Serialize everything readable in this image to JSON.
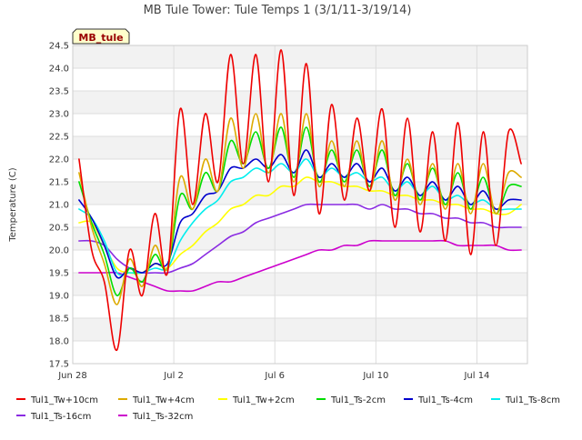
{
  "chart_data": {
    "type": "line",
    "title": "MB Tule Tower: Tule Temps 1 (3/1/11-3/19/14)",
    "xlabel": "",
    "ylabel": "Temperature (C)",
    "badge": "MB_tule",
    "xlim": [
      "2012-06-28",
      "2012-07-16"
    ],
    "ylim": [
      17.5,
      24.5
    ],
    "xticks": [
      {
        "date": "2012-06-28",
        "label": "Jun 28"
      },
      {
        "date": "2012-07-02",
        "label": "Jul 2"
      },
      {
        "date": "2012-07-06",
        "label": "Jul 6"
      },
      {
        "date": "2012-07-10",
        "label": "Jul 10"
      },
      {
        "date": "2012-07-14",
        "label": "Jul 14"
      }
    ],
    "yticks": [
      17.5,
      18.0,
      18.5,
      19.0,
      19.5,
      20.0,
      20.5,
      21.0,
      21.5,
      22.0,
      22.5,
      23.0,
      23.5,
      24.0,
      24.5
    ],
    "grid": true,
    "legend_position": "bottom",
    "series": [
      {
        "name": "Tul1_Tw+10cm",
        "color": "#ee0000",
        "x": [
          "2012-06-28T06:00",
          "2012-06-28T18:00",
          "2012-06-29T06:00",
          "2012-06-29T18:00",
          "2012-06-30T06:00",
          "2012-06-30T18:00",
          "2012-07-01T06:00",
          "2012-07-01T18:00",
          "2012-07-02T06:00",
          "2012-07-02T18:00",
          "2012-07-03T06:00",
          "2012-07-03T18:00",
          "2012-07-04T06:00",
          "2012-07-04T18:00",
          "2012-07-05T06:00",
          "2012-07-05T18:00",
          "2012-07-06T06:00",
          "2012-07-06T18:00",
          "2012-07-07T06:00",
          "2012-07-07T18:00",
          "2012-07-08T06:00",
          "2012-07-08T18:00",
          "2012-07-09T06:00",
          "2012-07-09T18:00",
          "2012-07-10T06:00",
          "2012-07-10T18:00",
          "2012-07-11T06:00",
          "2012-07-11T18:00",
          "2012-07-12T06:00",
          "2012-07-12T18:00",
          "2012-07-13T06:00",
          "2012-07-13T18:00",
          "2012-07-14T06:00",
          "2012-07-14T18:00",
          "2012-07-15T06:00",
          "2012-07-15T18:00"
        ],
        "y": [
          22.0,
          20.0,
          19.3,
          17.8,
          20.0,
          19.0,
          20.8,
          19.5,
          23.1,
          21.0,
          23.0,
          21.5,
          24.3,
          21.9,
          24.3,
          21.5,
          24.4,
          21.2,
          24.1,
          20.8,
          23.2,
          21.1,
          22.9,
          21.3,
          23.1,
          20.5,
          22.9,
          20.4,
          22.6,
          20.2,
          22.8,
          19.9,
          22.6,
          20.1,
          22.6,
          21.9
        ]
      },
      {
        "name": "Tul1_Tw+4cm",
        "color": "#ddaa00",
        "x": [
          "2012-06-28T06:00",
          "2012-06-28T18:00",
          "2012-06-29T06:00",
          "2012-06-29T18:00",
          "2012-06-30T06:00",
          "2012-06-30T18:00",
          "2012-07-01T06:00",
          "2012-07-01T18:00",
          "2012-07-02T06:00",
          "2012-07-02T18:00",
          "2012-07-03T06:00",
          "2012-07-03T18:00",
          "2012-07-04T06:00",
          "2012-07-04T18:00",
          "2012-07-05T06:00",
          "2012-07-05T18:00",
          "2012-07-06T06:00",
          "2012-07-06T18:00",
          "2012-07-07T06:00",
          "2012-07-07T18:00",
          "2012-07-08T06:00",
          "2012-07-08T18:00",
          "2012-07-09T06:00",
          "2012-07-09T18:00",
          "2012-07-10T06:00",
          "2012-07-10T18:00",
          "2012-07-11T06:00",
          "2012-07-11T18:00",
          "2012-07-12T06:00",
          "2012-07-12T18:00",
          "2012-07-13T06:00",
          "2012-07-13T18:00",
          "2012-07-14T06:00",
          "2012-07-14T18:00",
          "2012-07-15T06:00",
          "2012-07-15T18:00"
        ],
        "y": [
          21.7,
          20.5,
          19.7,
          18.8,
          19.8,
          19.2,
          20.1,
          19.6,
          21.6,
          20.9,
          22.0,
          21.3,
          22.9,
          21.8,
          23.0,
          21.7,
          23.0,
          21.5,
          23.0,
          21.4,
          22.4,
          21.4,
          22.4,
          21.3,
          22.4,
          21.1,
          22.0,
          21.0,
          21.9,
          20.9,
          21.9,
          20.8,
          21.9,
          20.8,
          21.7,
          21.6
        ]
      },
      {
        "name": "Tul1_Tw+2cm",
        "color": "#ffff00",
        "x": [
          "2012-06-28T06:00",
          "2012-06-28T18:00",
          "2012-06-29T06:00",
          "2012-06-29T18:00",
          "2012-06-30T06:00",
          "2012-06-30T18:00",
          "2012-07-01T06:00",
          "2012-07-01T18:00",
          "2012-07-02T06:00",
          "2012-07-02T18:00",
          "2012-07-03T06:00",
          "2012-07-03T18:00",
          "2012-07-04T06:00",
          "2012-07-04T18:00",
          "2012-07-05T06:00",
          "2012-07-05T18:00",
          "2012-07-06T06:00",
          "2012-07-06T18:00",
          "2012-07-07T06:00",
          "2012-07-07T18:00",
          "2012-07-08T06:00",
          "2012-07-08T18:00",
          "2012-07-09T06:00",
          "2012-07-09T18:00",
          "2012-07-10T06:00",
          "2012-07-10T18:00",
          "2012-07-11T06:00",
          "2012-07-11T18:00",
          "2012-07-12T06:00",
          "2012-07-12T18:00",
          "2012-07-13T06:00",
          "2012-07-13T18:00",
          "2012-07-14T06:00",
          "2012-07-14T18:00",
          "2012-07-15T06:00",
          "2012-07-15T18:00"
        ],
        "y": [
          20.6,
          20.6,
          20.1,
          19.6,
          19.5,
          19.5,
          19.7,
          19.6,
          19.9,
          20.1,
          20.4,
          20.6,
          20.9,
          21.0,
          21.2,
          21.2,
          21.4,
          21.4,
          21.6,
          21.5,
          21.5,
          21.4,
          21.4,
          21.3,
          21.3,
          21.2,
          21.2,
          21.1,
          21.1,
          21.0,
          21.0,
          20.9,
          20.9,
          20.8,
          20.8,
          21.0
        ]
      },
      {
        "name": "Tul1_Ts-2cm",
        "color": "#00dd00",
        "x": [
          "2012-06-28T06:00",
          "2012-06-28T18:00",
          "2012-06-29T06:00",
          "2012-06-29T18:00",
          "2012-06-30T06:00",
          "2012-06-30T18:00",
          "2012-07-01T06:00",
          "2012-07-01T18:00",
          "2012-07-02T06:00",
          "2012-07-02T18:00",
          "2012-07-03T06:00",
          "2012-07-03T18:00",
          "2012-07-04T06:00",
          "2012-07-04T18:00",
          "2012-07-05T06:00",
          "2012-07-05T18:00",
          "2012-07-06T06:00",
          "2012-07-06T18:00",
          "2012-07-07T06:00",
          "2012-07-07T18:00",
          "2012-07-08T06:00",
          "2012-07-08T18:00",
          "2012-07-09T06:00",
          "2012-07-09T18:00",
          "2012-07-10T06:00",
          "2012-07-10T18:00",
          "2012-07-11T06:00",
          "2012-07-11T18:00",
          "2012-07-12T06:00",
          "2012-07-12T18:00",
          "2012-07-13T06:00",
          "2012-07-13T18:00",
          "2012-07-14T06:00",
          "2012-07-14T18:00",
          "2012-07-15T06:00",
          "2012-07-15T18:00"
        ],
        "y": [
          21.5,
          20.6,
          19.9,
          19.0,
          19.6,
          19.3,
          19.9,
          19.6,
          21.2,
          20.9,
          21.7,
          21.3,
          22.4,
          21.9,
          22.6,
          21.8,
          22.7,
          21.6,
          22.7,
          21.5,
          22.2,
          21.5,
          22.2,
          21.4,
          22.2,
          21.2,
          21.9,
          21.1,
          21.8,
          21.0,
          21.7,
          20.9,
          21.6,
          20.8,
          21.4,
          21.4
        ]
      },
      {
        "name": "Tul1_Ts-4cm",
        "color": "#0000cc",
        "x": [
          "2012-06-28T06:00",
          "2012-06-28T18:00",
          "2012-06-29T06:00",
          "2012-06-29T18:00",
          "2012-06-30T06:00",
          "2012-06-30T18:00",
          "2012-07-01T06:00",
          "2012-07-01T18:00",
          "2012-07-02T06:00",
          "2012-07-02T18:00",
          "2012-07-03T06:00",
          "2012-07-03T18:00",
          "2012-07-04T06:00",
          "2012-07-04T18:00",
          "2012-07-05T06:00",
          "2012-07-05T18:00",
          "2012-07-06T06:00",
          "2012-07-06T18:00",
          "2012-07-07T06:00",
          "2012-07-07T18:00",
          "2012-07-08T06:00",
          "2012-07-08T18:00",
          "2012-07-09T06:00",
          "2012-07-09T18:00",
          "2012-07-10T06:00",
          "2012-07-10T18:00",
          "2012-07-11T06:00",
          "2012-07-11T18:00",
          "2012-07-12T06:00",
          "2012-07-12T18:00",
          "2012-07-13T06:00",
          "2012-07-13T18:00",
          "2012-07-14T06:00",
          "2012-07-14T18:00",
          "2012-07-15T06:00",
          "2012-07-15T18:00"
        ],
        "y": [
          21.1,
          20.7,
          20.1,
          19.4,
          19.6,
          19.5,
          19.7,
          19.7,
          20.6,
          20.8,
          21.2,
          21.3,
          21.8,
          21.8,
          22.0,
          21.8,
          22.1,
          21.7,
          22.2,
          21.6,
          21.9,
          21.6,
          21.9,
          21.5,
          21.8,
          21.3,
          21.6,
          21.2,
          21.5,
          21.1,
          21.4,
          21.0,
          21.3,
          20.9,
          21.1,
          21.1
        ]
      },
      {
        "name": "Tul1_Ts-8cm",
        "color": "#00eeee",
        "x": [
          "2012-06-28T06:00",
          "2012-06-28T18:00",
          "2012-06-29T06:00",
          "2012-06-29T18:00",
          "2012-06-30T06:00",
          "2012-06-30T18:00",
          "2012-07-01T06:00",
          "2012-07-01T18:00",
          "2012-07-02T06:00",
          "2012-07-02T18:00",
          "2012-07-03T06:00",
          "2012-07-03T18:00",
          "2012-07-04T06:00",
          "2012-07-04T18:00",
          "2012-07-05T06:00",
          "2012-07-05T18:00",
          "2012-07-06T06:00",
          "2012-07-06T18:00",
          "2012-07-07T06:00",
          "2012-07-07T18:00",
          "2012-07-08T06:00",
          "2012-07-08T18:00",
          "2012-07-09T06:00",
          "2012-07-09T18:00",
          "2012-07-10T06:00",
          "2012-07-10T18:00",
          "2012-07-11T06:00",
          "2012-07-11T18:00",
          "2012-07-12T06:00",
          "2012-07-12T18:00",
          "2012-07-13T06:00",
          "2012-07-13T18:00",
          "2012-07-14T06:00",
          "2012-07-14T18:00",
          "2012-07-15T06:00",
          "2012-07-15T18:00"
        ],
        "y": [
          20.9,
          20.7,
          20.2,
          19.5,
          19.5,
          19.5,
          19.6,
          19.6,
          20.2,
          20.6,
          20.9,
          21.1,
          21.5,
          21.6,
          21.8,
          21.7,
          21.9,
          21.7,
          22.0,
          21.6,
          21.8,
          21.6,
          21.7,
          21.5,
          21.6,
          21.3,
          21.5,
          21.2,
          21.4,
          21.1,
          21.2,
          21.0,
          21.1,
          20.9,
          20.9,
          20.9
        ]
      },
      {
        "name": "Tul1_Ts-16cm",
        "color": "#8a2be2",
        "x": [
          "2012-06-28T06:00",
          "2012-06-28T18:00",
          "2012-06-29T06:00",
          "2012-06-29T18:00",
          "2012-06-30T06:00",
          "2012-06-30T18:00",
          "2012-07-01T06:00",
          "2012-07-01T18:00",
          "2012-07-02T06:00",
          "2012-07-02T18:00",
          "2012-07-03T06:00",
          "2012-07-03T18:00",
          "2012-07-04T06:00",
          "2012-07-04T18:00",
          "2012-07-05T06:00",
          "2012-07-05T18:00",
          "2012-07-06T06:00",
          "2012-07-06T18:00",
          "2012-07-07T06:00",
          "2012-07-07T18:00",
          "2012-07-08T06:00",
          "2012-07-08T18:00",
          "2012-07-09T06:00",
          "2012-07-09T18:00",
          "2012-07-10T06:00",
          "2012-07-10T18:00",
          "2012-07-11T06:00",
          "2012-07-11T18:00",
          "2012-07-12T06:00",
          "2012-07-12T18:00",
          "2012-07-13T06:00",
          "2012-07-13T18:00",
          "2012-07-14T06:00",
          "2012-07-14T18:00",
          "2012-07-15T06:00",
          "2012-07-15T18:00"
        ],
        "y": [
          20.2,
          20.2,
          20.1,
          19.8,
          19.6,
          19.5,
          19.5,
          19.5,
          19.6,
          19.7,
          19.9,
          20.1,
          20.3,
          20.4,
          20.6,
          20.7,
          20.8,
          20.9,
          21.0,
          21.0,
          21.0,
          21.0,
          21.0,
          20.9,
          21.0,
          20.9,
          20.9,
          20.8,
          20.8,
          20.7,
          20.7,
          20.6,
          20.6,
          20.5,
          20.5,
          20.5
        ]
      },
      {
        "name": "Tul1_Ts-32cm",
        "color": "#cc00cc",
        "x": [
          "2012-06-28T06:00",
          "2012-06-28T18:00",
          "2012-06-29T06:00",
          "2012-06-29T18:00",
          "2012-06-30T06:00",
          "2012-06-30T18:00",
          "2012-07-01T06:00",
          "2012-07-01T18:00",
          "2012-07-02T06:00",
          "2012-07-02T18:00",
          "2012-07-03T06:00",
          "2012-07-03T18:00",
          "2012-07-04T06:00",
          "2012-07-04T18:00",
          "2012-07-05T06:00",
          "2012-07-05T18:00",
          "2012-07-06T06:00",
          "2012-07-06T18:00",
          "2012-07-07T06:00",
          "2012-07-07T18:00",
          "2012-07-08T06:00",
          "2012-07-08T18:00",
          "2012-07-09T06:00",
          "2012-07-09T18:00",
          "2012-07-10T06:00",
          "2012-07-10T18:00",
          "2012-07-11T06:00",
          "2012-07-11T18:00",
          "2012-07-12T06:00",
          "2012-07-12T18:00",
          "2012-07-13T06:00",
          "2012-07-13T18:00",
          "2012-07-14T06:00",
          "2012-07-14T18:00",
          "2012-07-15T06:00",
          "2012-07-15T18:00"
        ],
        "y": [
          19.5,
          19.5,
          19.5,
          19.5,
          19.4,
          19.3,
          19.2,
          19.1,
          19.1,
          19.1,
          19.2,
          19.3,
          19.3,
          19.4,
          19.5,
          19.6,
          19.7,
          19.8,
          19.9,
          20.0,
          20.0,
          20.1,
          20.1,
          20.2,
          20.2,
          20.2,
          20.2,
          20.2,
          20.2,
          20.2,
          20.1,
          20.1,
          20.1,
          20.1,
          20.0,
          20.0
        ]
      }
    ]
  }
}
